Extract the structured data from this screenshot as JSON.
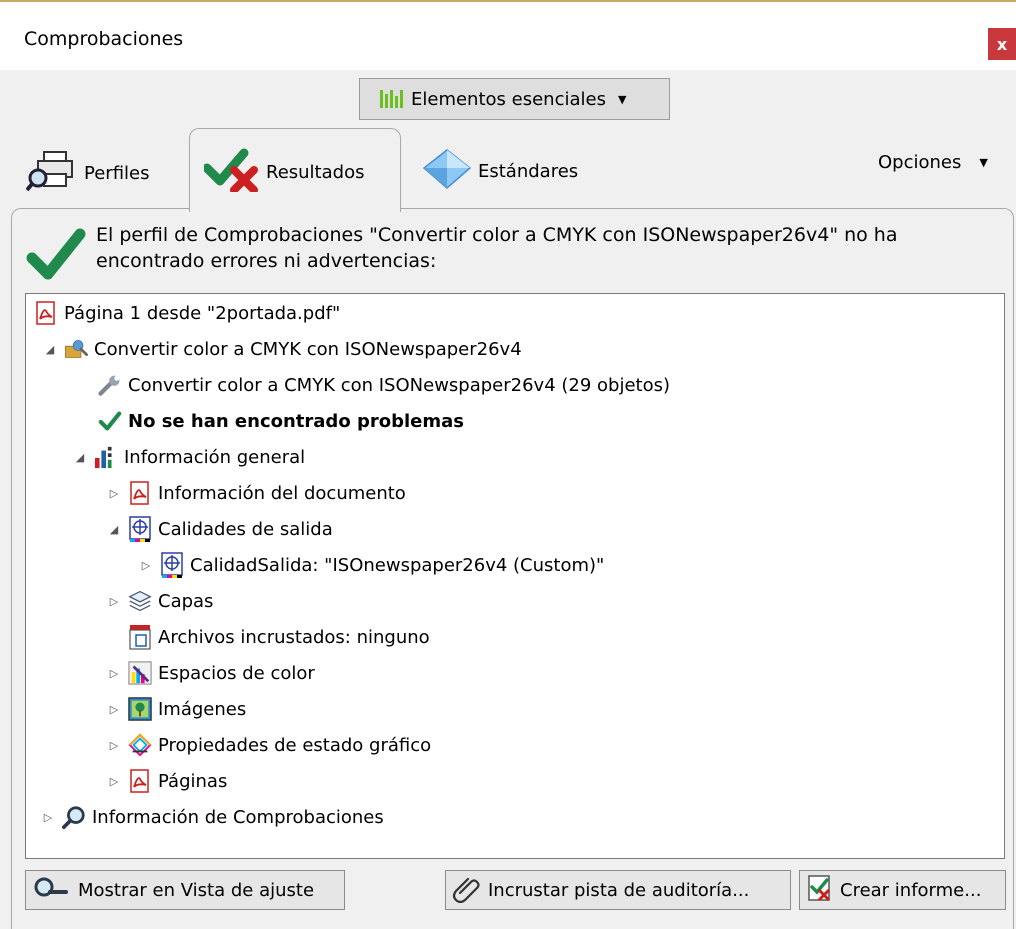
{
  "window": {
    "title": "Comprobaciones",
    "close_label": "x"
  },
  "toolbar": {
    "dropdown_label": "Elementos esenciales",
    "accent_color": "#6bbf1f"
  },
  "tabs": [
    {
      "label": "Perfiles",
      "icon": "printer-magnifier-icon"
    },
    {
      "label": "Resultados",
      "icon": "check-cross-icon",
      "active": true
    },
    {
      "label": "Estándares",
      "icon": "diamond-icon"
    }
  ],
  "options": {
    "label": "Opciones"
  },
  "summary": {
    "message": "El perfil de Comprobaciones \"Convertir color a CMYK con ISONewspaper26v4\" no ha encontrado errores ni advertencias:",
    "status_color": "#1f8a4c"
  },
  "tree": [
    {
      "label": "Página 1 desde \"2portada.pdf\"",
      "icon": "pdf-icon",
      "expander": ""
    },
    {
      "label": "Convertir color a CMYK con ISONewspaper26v4",
      "icon": "fixup-profile-icon",
      "expander": "expanded"
    },
    {
      "label": "Convertir color a CMYK con ISONewspaper26v4 (29 objetos)",
      "icon": "wrench-icon",
      "expander": ""
    },
    {
      "label": "No se han encontrado problemas",
      "icon": "check-icon",
      "expander": "",
      "bold": true
    },
    {
      "label": "Información general",
      "icon": "chart-icon",
      "expander": "expanded"
    },
    {
      "label": "Información del documento",
      "icon": "pdf-icon",
      "expander": "collapsed"
    },
    {
      "label": "Calidades de salida",
      "icon": "output-intent-icon",
      "expander": "expanded"
    },
    {
      "label": "CalidadSalida: \"ISOnewspaper26v4 (Custom)\"",
      "icon": "output-intent-icon",
      "expander": "collapsed"
    },
    {
      "label": "Capas",
      "icon": "layers-icon",
      "expander": "collapsed"
    },
    {
      "label": "Archivos incrustados: ninguno",
      "icon": "embedded-file-icon",
      "expander": ""
    },
    {
      "label": "Espacios de color",
      "icon": "color-space-icon",
      "expander": "collapsed"
    },
    {
      "label": "Imágenes",
      "icon": "image-icon",
      "expander": "collapsed"
    },
    {
      "label": "Propiedades de estado gráfico",
      "icon": "graphic-state-icon",
      "expander": "collapsed"
    },
    {
      "label": "Páginas",
      "icon": "pdf-icon",
      "expander": "collapsed"
    },
    {
      "label": "Información de Comprobaciones",
      "icon": "magnifier-icon",
      "expander": "collapsed"
    }
  ],
  "buttons": {
    "show_in_snap": "Mostrar en Vista de ajuste",
    "embed_audit": "Incrustar pista de auditoría...",
    "create_report": "Crear informe..."
  }
}
